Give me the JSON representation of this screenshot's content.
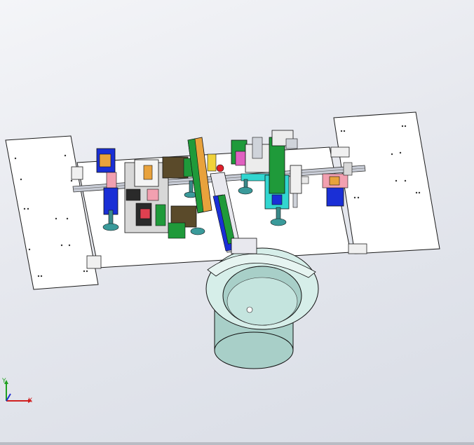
{
  "viewport": {
    "background_top": "#f4f5f8",
    "background_bottom": "#d9dde6"
  },
  "model": {
    "plate_color": "#ffffff",
    "edge_color": "#1a1a1a",
    "bowl_color": "#bfe3dc",
    "accent_colors": {
      "blue": "#1a2fd6",
      "green": "#1f9a3a",
      "cyan": "#32d6d0",
      "orange": "#e8a23c",
      "yellow": "#f0d23a",
      "pink": "#f2a0b0",
      "teal": "#3a8a8a",
      "brown": "#5a4a2a",
      "red": "#e0202a"
    }
  },
  "triad": {
    "x_label": "X",
    "y_label": "Y",
    "x_color": "#d02020",
    "y_color": "#20a020",
    "z_color": "#2030d0"
  }
}
